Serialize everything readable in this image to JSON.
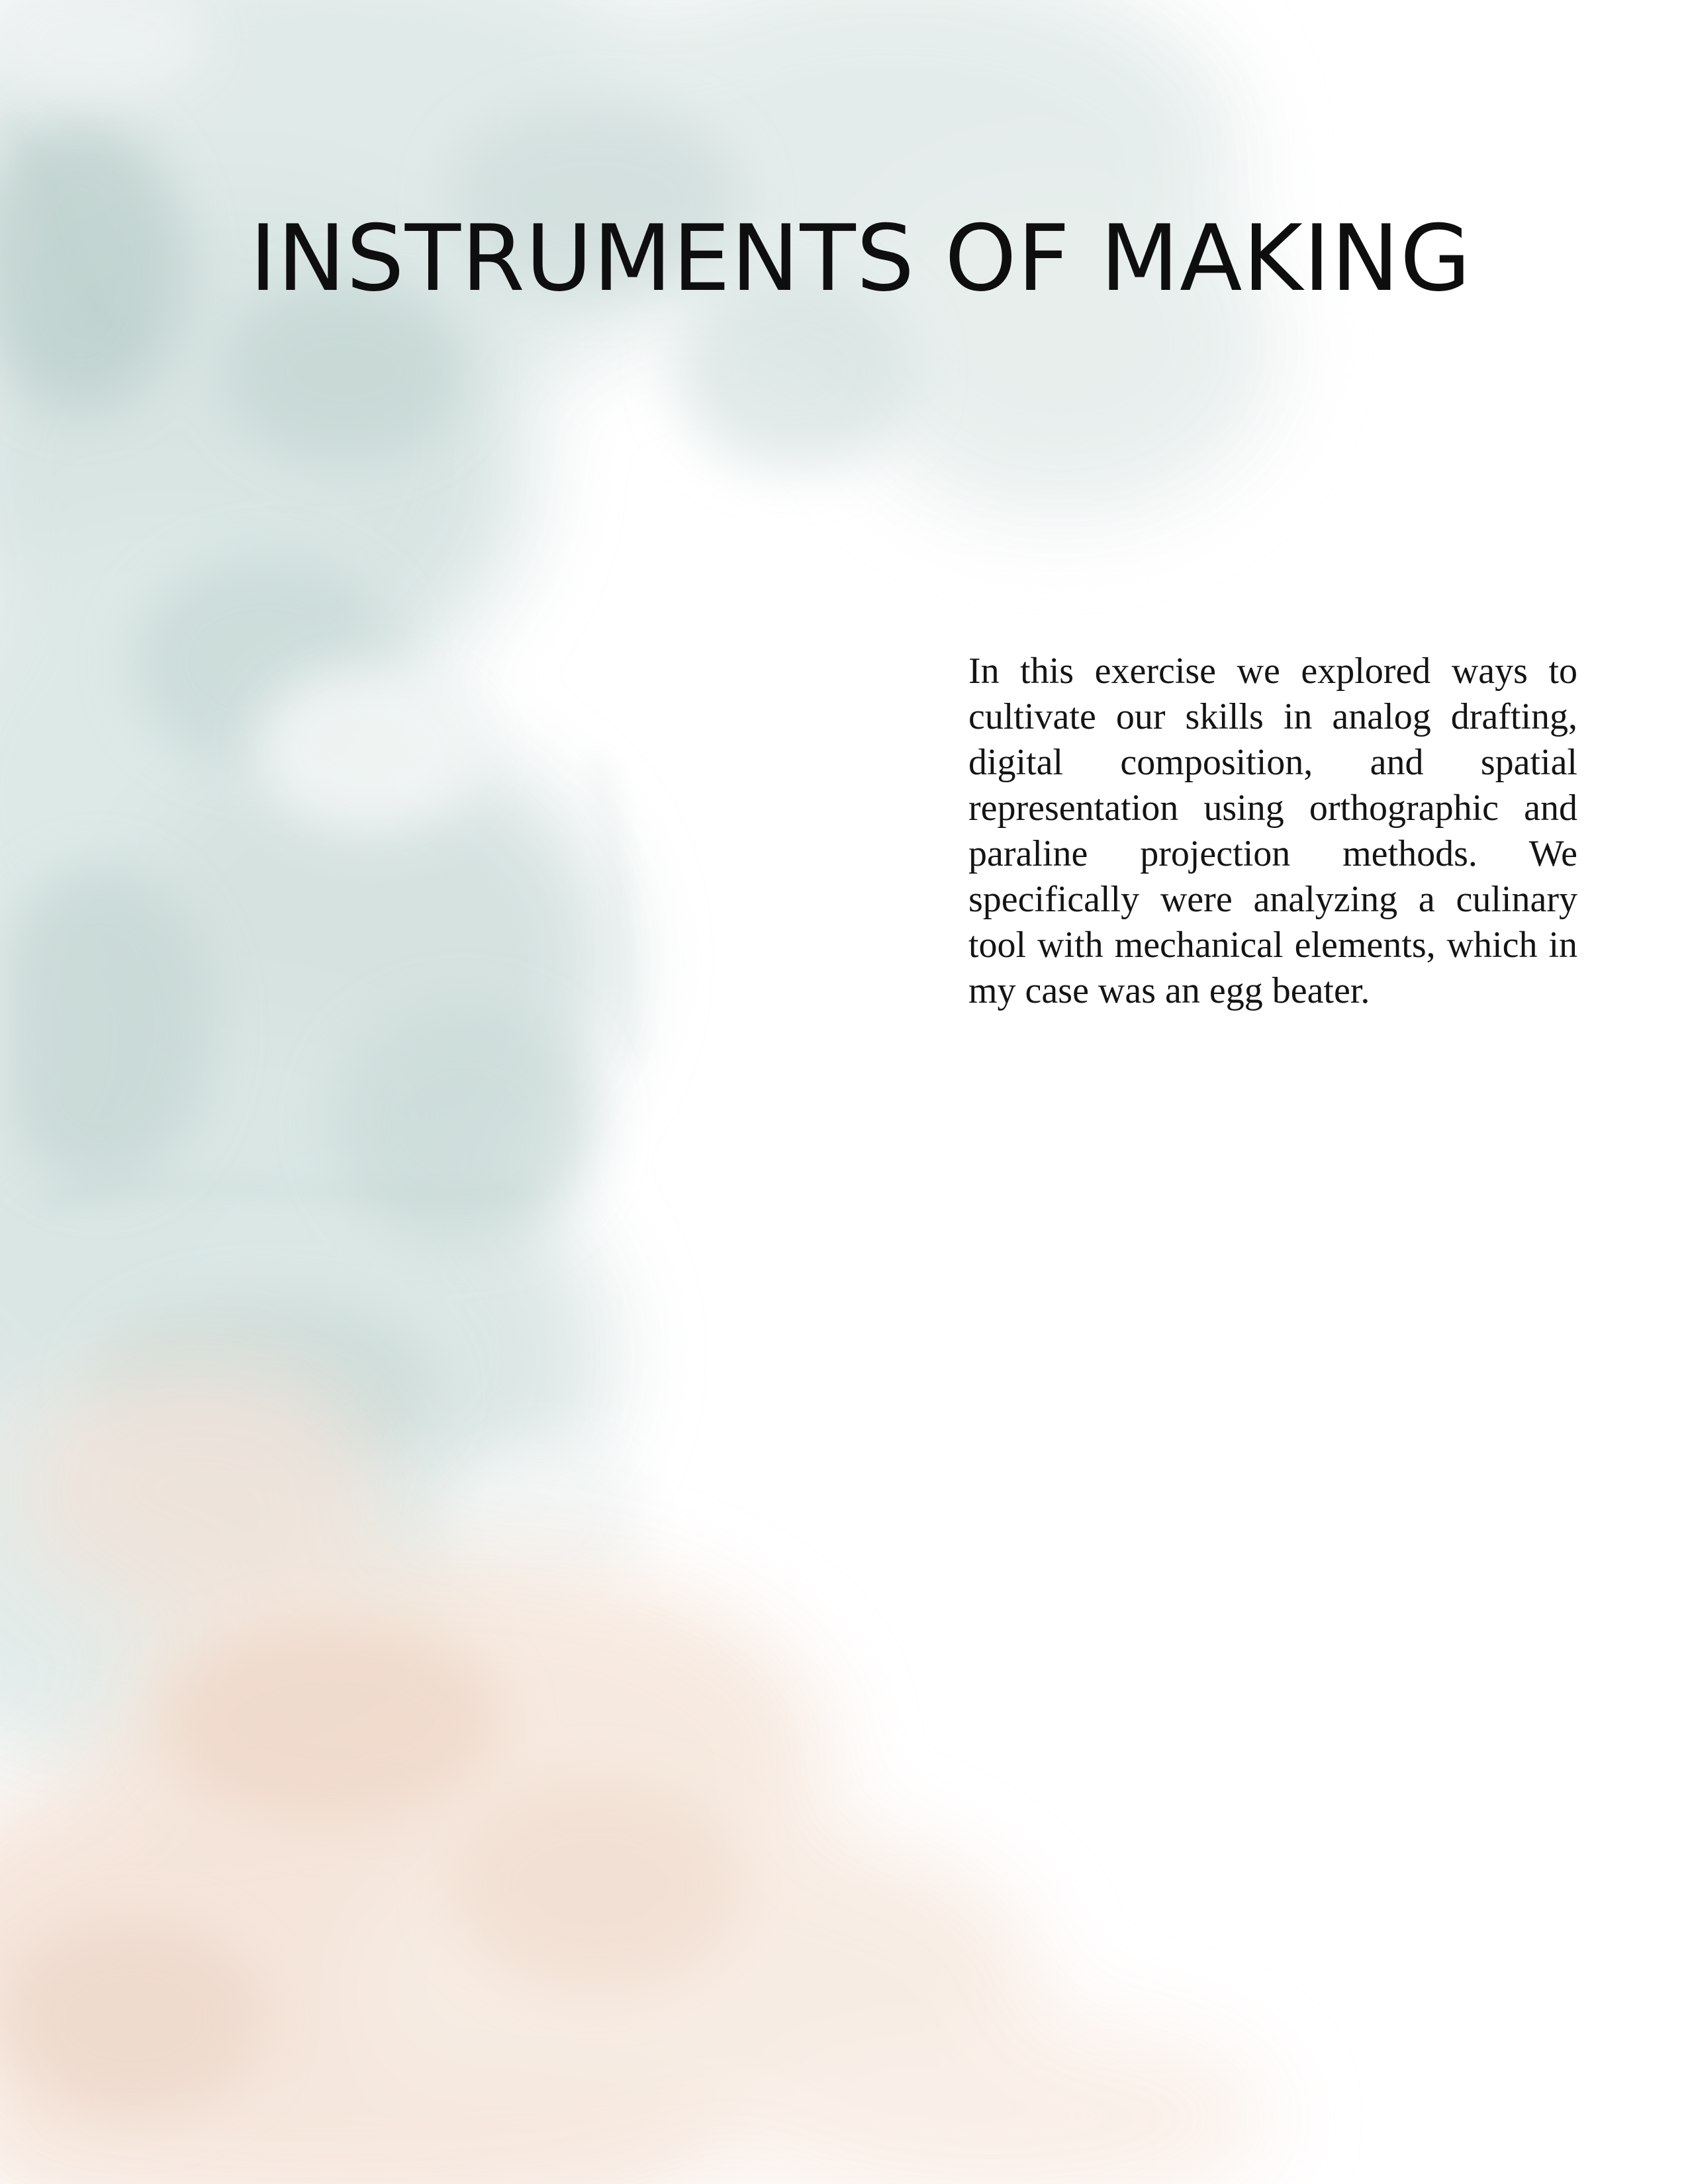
{
  "page": {
    "title": "INSTRUMENTS OF MAKING",
    "body": "In this exercise we explored ways to cultivate our skills in analog drafting, digital composition, and spatial representation using orthographic and paraline projection methods. We specifically were analyzing a culinary tool with mechanical elements, which in my case was an egg beater."
  },
  "colors": {
    "background": "#ffffff",
    "wash_blue_grey": "#c9d9d6",
    "wash_peach": "#f2d9c8",
    "text": "#111111"
  }
}
